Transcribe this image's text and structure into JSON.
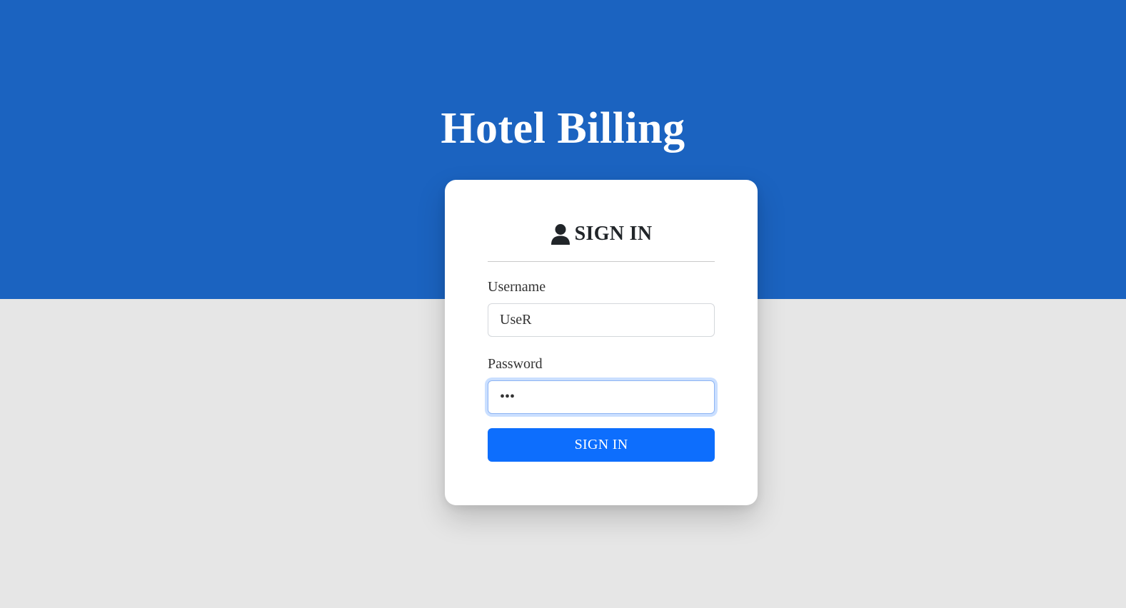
{
  "app": {
    "title": "Hotel Billing"
  },
  "login_card": {
    "icon": "user-icon",
    "heading": "SIGN IN",
    "username": {
      "label": "Username",
      "value": "UseR"
    },
    "password": {
      "label": "Password",
      "value": "abc"
    },
    "submit_label": "SIGN IN"
  },
  "colors": {
    "banner": "#1b63c0",
    "background": "#e6e6e6",
    "button": "#0d6efd",
    "card": "#ffffff"
  }
}
